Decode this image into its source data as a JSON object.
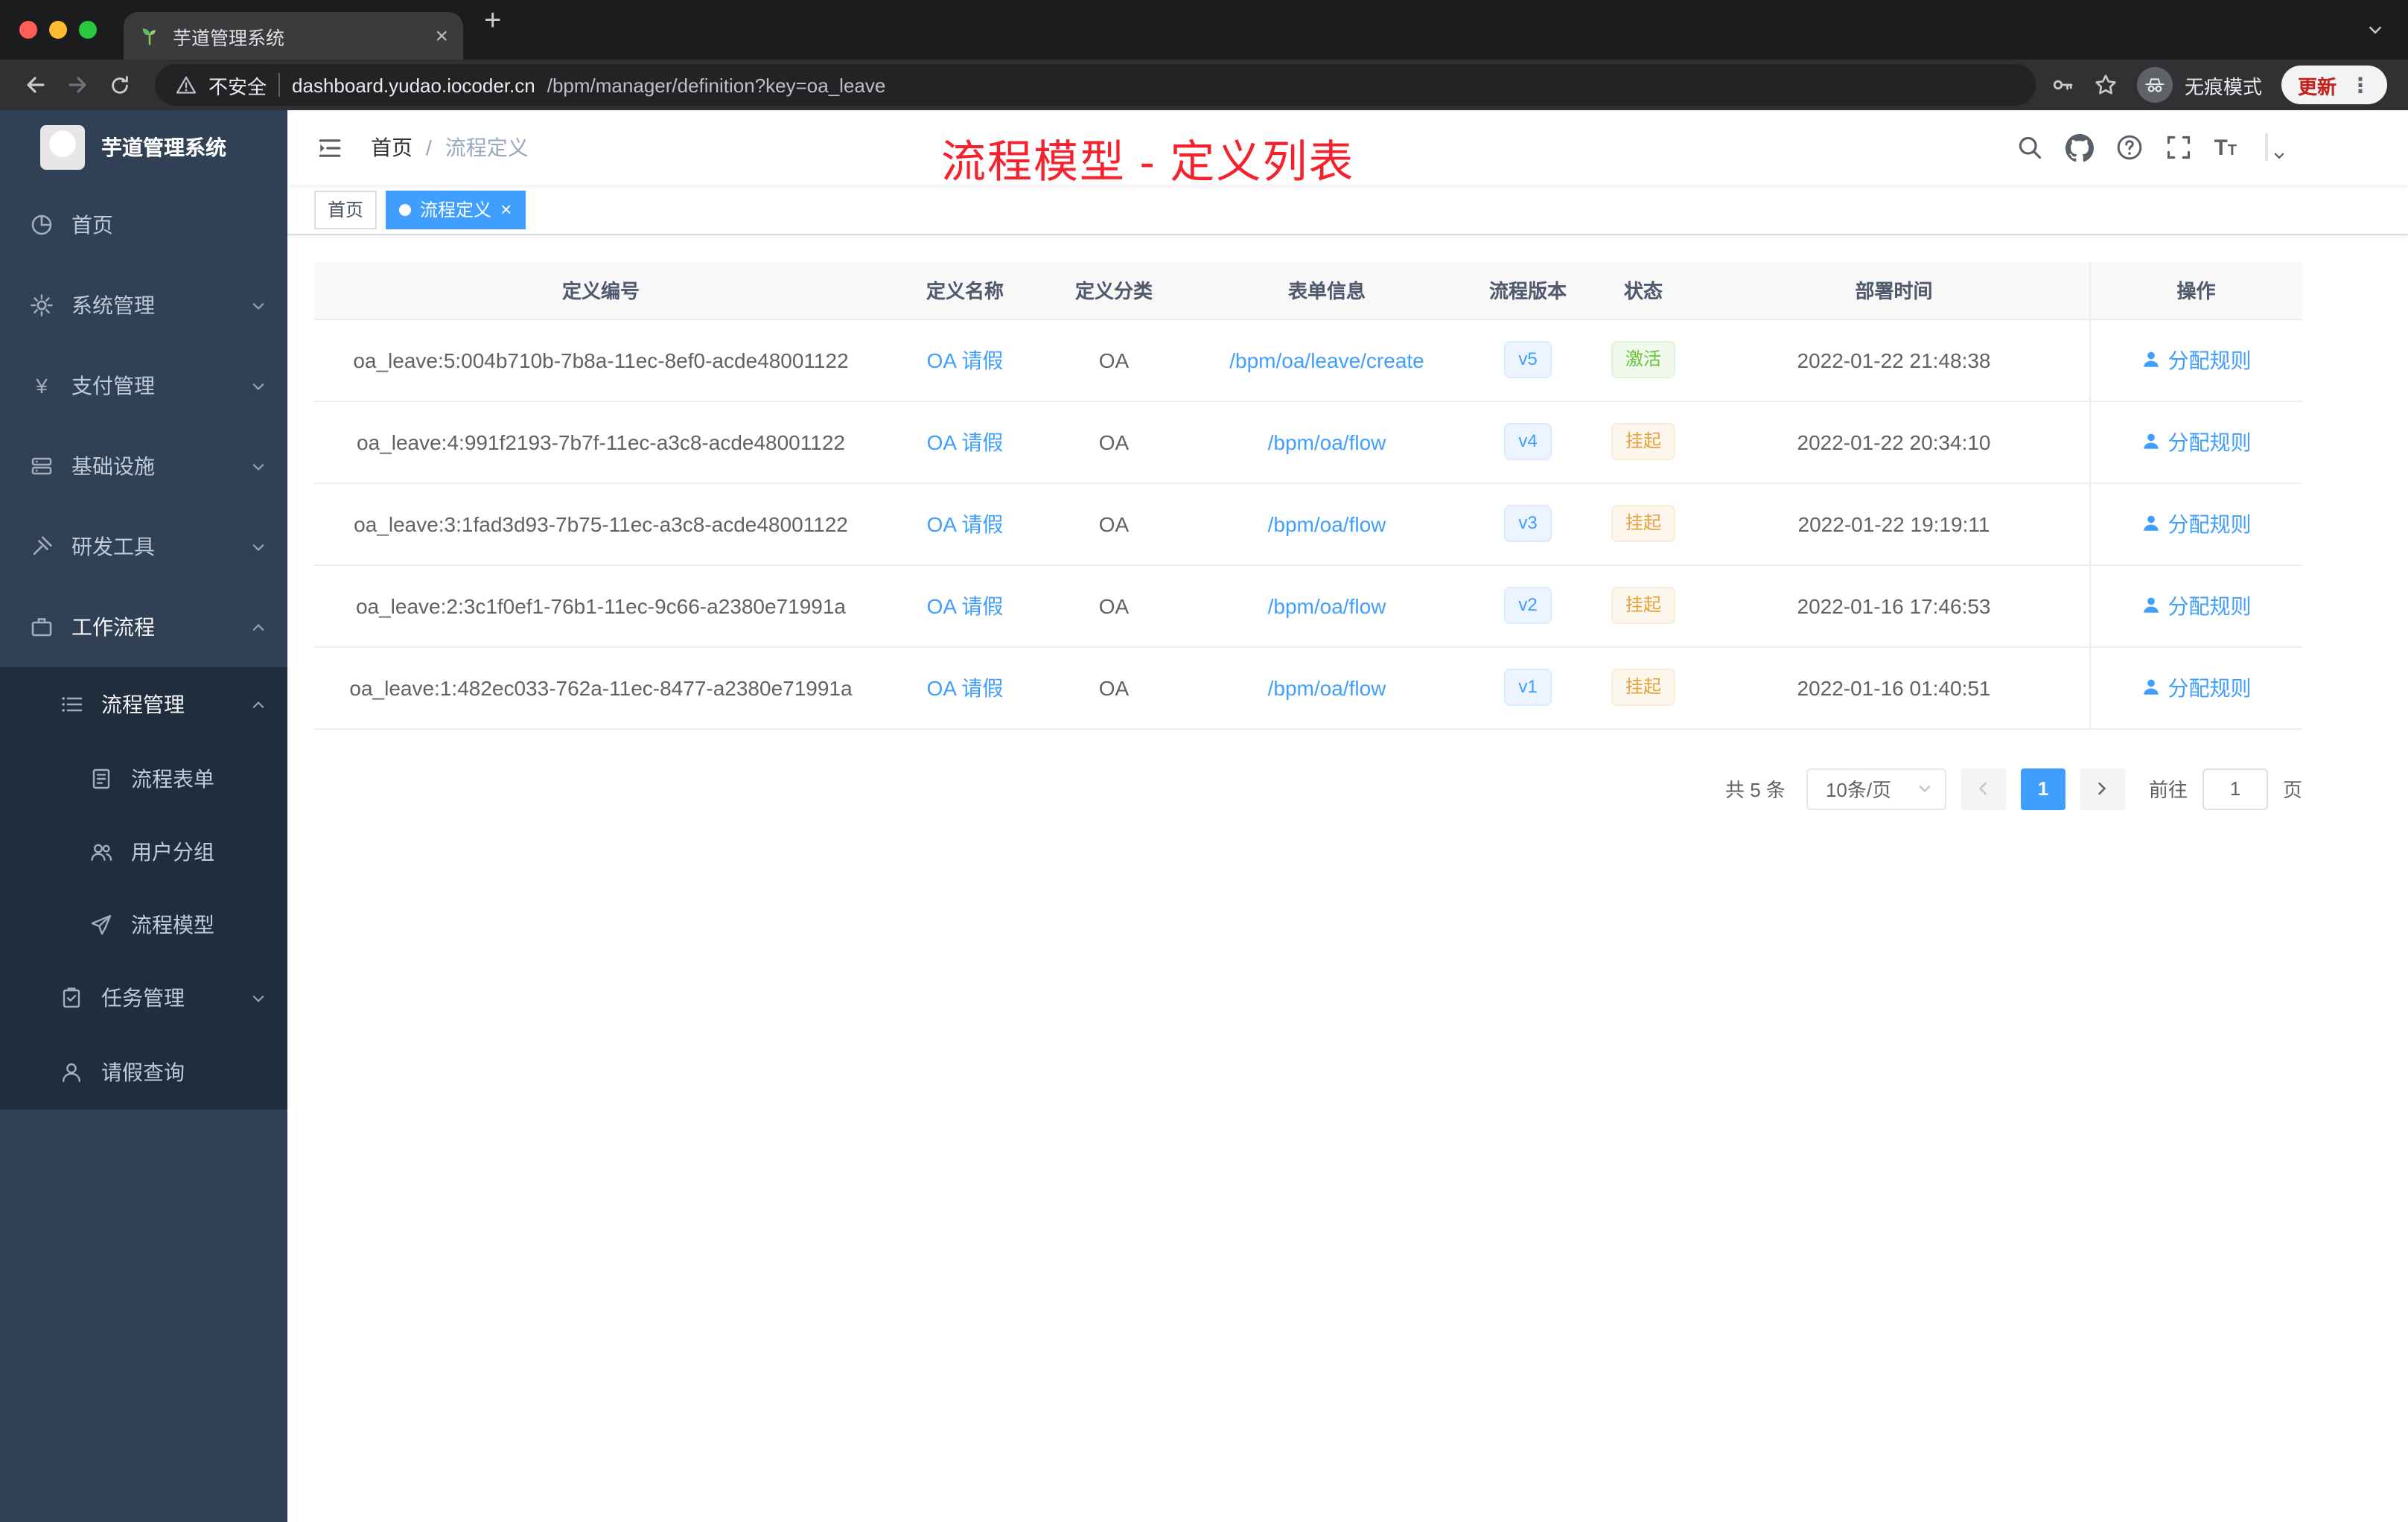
{
  "browser": {
    "tab_title": "芋道管理系统",
    "security_label": "不安全",
    "url_host": "dashboard.yudao.iocoder.cn",
    "url_path": "/bpm/manager/definition?key=oa_leave",
    "incognito_label": "无痕模式",
    "update_label": "更新"
  },
  "sidebar": {
    "logo_title": "芋道管理系统",
    "items": [
      {
        "label": "首页"
      },
      {
        "label": "系统管理"
      },
      {
        "label": "支付管理"
      },
      {
        "label": "基础设施"
      },
      {
        "label": "研发工具"
      },
      {
        "label": "工作流程"
      },
      {
        "label": "流程管理"
      },
      {
        "label": "流程表单"
      },
      {
        "label": "用户分组"
      },
      {
        "label": "流程模型"
      },
      {
        "label": "任务管理"
      },
      {
        "label": "请假查询"
      }
    ]
  },
  "navbar": {
    "breadcrumb_home": "首页",
    "breadcrumb_sep": "/",
    "breadcrumb_current": "流程定义"
  },
  "annotation": {
    "title": "流程模型 - 定义列表"
  },
  "tags": {
    "home": "首页",
    "active": "流程定义"
  },
  "table": {
    "columns": [
      "定义编号",
      "定义名称",
      "定义分类",
      "表单信息",
      "流程版本",
      "状态",
      "部署时间",
      "操作"
    ],
    "rows": [
      {
        "id": "oa_leave:5:004b710b-7b8a-11ec-8ef0-acde48001122",
        "name": "OA 请假",
        "category": "OA",
        "form": "/bpm/oa/leave/create",
        "version": "v5",
        "status": "激活",
        "time": "2022-01-22 21:48:38",
        "action": "分配规则"
      },
      {
        "id": "oa_leave:4:991f2193-7b7f-11ec-a3c8-acde48001122",
        "name": "OA 请假",
        "category": "OA",
        "form": "/bpm/oa/flow",
        "version": "v4",
        "status": "挂起",
        "time": "2022-01-22 20:34:10",
        "action": "分配规则"
      },
      {
        "id": "oa_leave:3:1fad3d93-7b75-11ec-a3c8-acde48001122",
        "name": "OA 请假",
        "category": "OA",
        "form": "/bpm/oa/flow",
        "version": "v3",
        "status": "挂起",
        "time": "2022-01-22 19:19:11",
        "action": "分配规则"
      },
      {
        "id": "oa_leave:2:3c1f0ef1-76b1-11ec-9c66-a2380e71991a",
        "name": "OA 请假",
        "category": "OA",
        "form": "/bpm/oa/flow",
        "version": "v2",
        "status": "挂起",
        "time": "2022-01-16 17:46:53",
        "action": "分配规则"
      },
      {
        "id": "oa_leave:1:482ec033-762a-11ec-8477-a2380e71991a",
        "name": "OA 请假",
        "category": "OA",
        "form": "/bpm/oa/flow",
        "version": "v1",
        "status": "挂起",
        "time": "2022-01-16 01:40:51",
        "action": "分配规则"
      }
    ]
  },
  "pagination": {
    "total": "共 5 条",
    "page_size": "10条/页",
    "current_page": "1",
    "goto_label": "前往",
    "goto_value": "1",
    "unit_label": "页"
  },
  "icons": {
    "yen": "¥",
    "close": "×",
    "plus": "+",
    "more": "⋮",
    "question": "?",
    "font_large": "T",
    "font_small": "T"
  },
  "colors": {
    "accent": "#409eff",
    "success": "#67c23a",
    "warning": "#e6a23c",
    "annotation": "#f5222d"
  }
}
